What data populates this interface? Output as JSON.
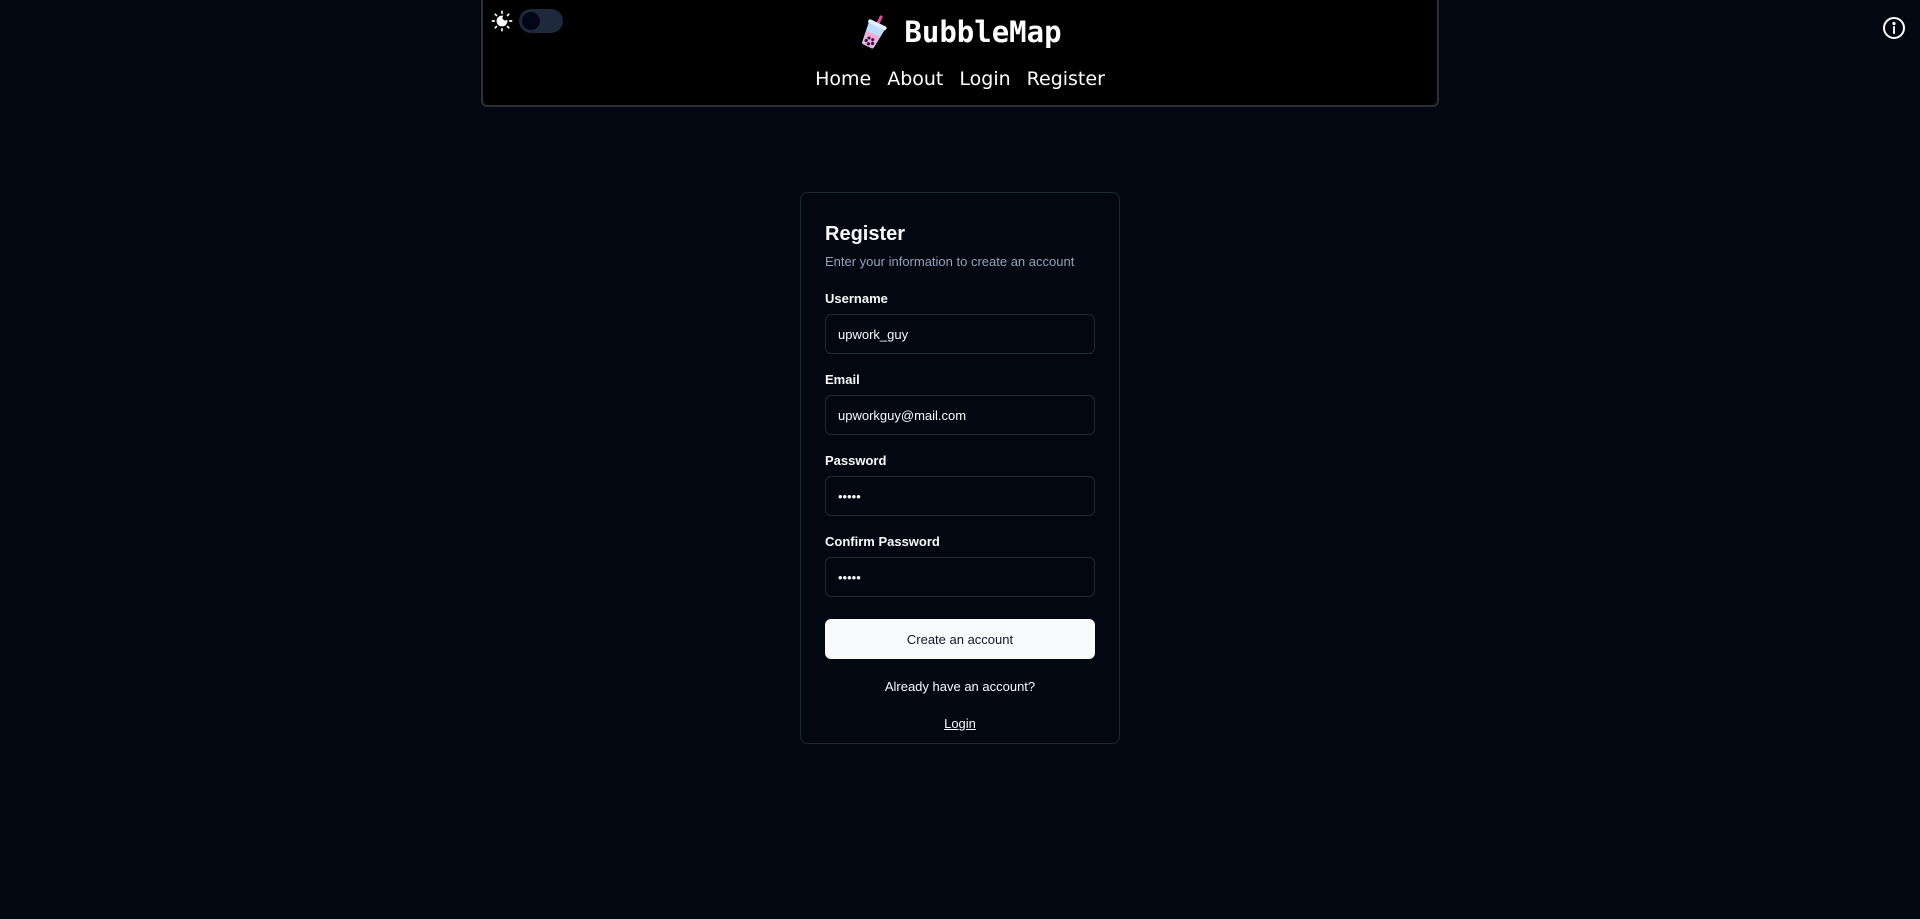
{
  "header": {
    "brand": "BubbleMap",
    "nav": [
      "Home",
      "About",
      "Login",
      "Register"
    ],
    "theme_toggle_icon": "sun-moon-icon",
    "logo_icon": "bubble-tea-icon"
  },
  "info_icon": "info-icon",
  "form": {
    "title": "Register",
    "description": "Enter your information to create an account",
    "username_label": "Username",
    "username_value": "upwork_guy",
    "email_label": "Email",
    "email_value": "upworkguy@mail.com",
    "password_label": "Password",
    "password_value": "•••••",
    "confirm_label": "Confirm Password",
    "confirm_value": "•••••",
    "submit_label": "Create an account",
    "have_account_text": "Already have an account?",
    "login_link": "Login"
  },
  "colors": {
    "background": "#030712",
    "header_bg": "#000000",
    "card_border": "#1f2937",
    "button_bg": "#f8fafc"
  }
}
